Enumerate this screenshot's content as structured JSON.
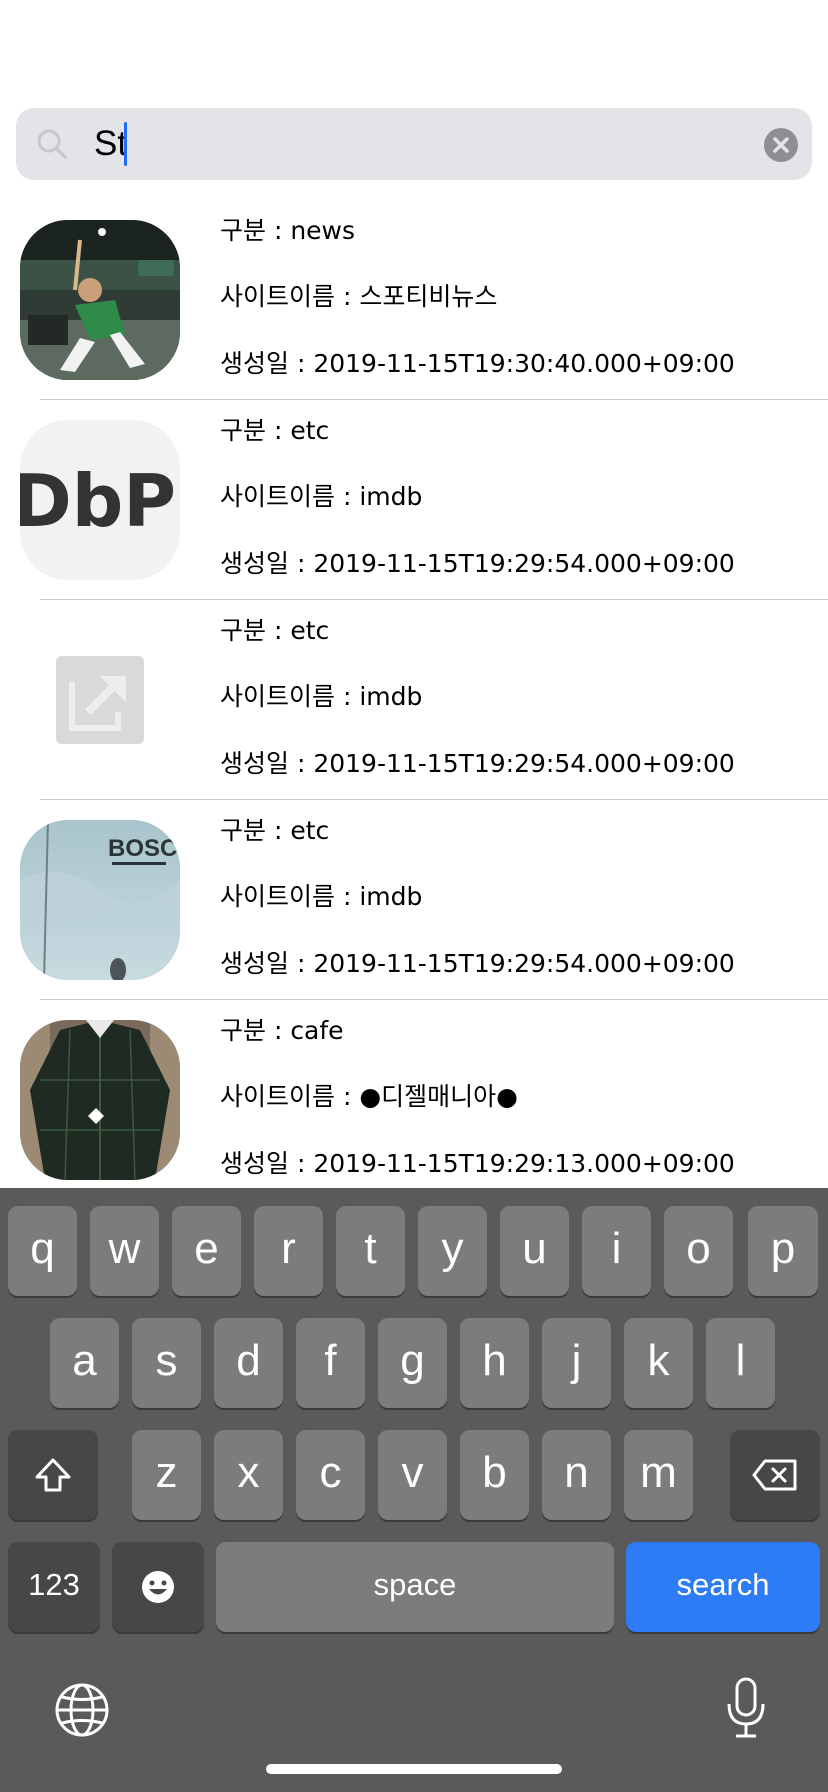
{
  "search": {
    "query": "St"
  },
  "results": [
    {
      "category_line": "구분 : news",
      "site_line": "사이트이름 : 스포티비뉴스",
      "date_line": "생성일 : 2019-11-15T19:30:40.000+09:00"
    },
    {
      "category_line": "구분 : etc",
      "site_line": "사이트이름 : imdb",
      "date_line": "생성일 : 2019-11-15T19:29:54.000+09:00"
    },
    {
      "category_line": "구분 : etc",
      "site_line": "사이트이름 : imdb",
      "date_line": "생성일 : 2019-11-15T19:29:54.000+09:00"
    },
    {
      "category_line": "구분 : etc",
      "site_line": "사이트이름 : imdb",
      "date_line": "생성일 : 2019-11-15T19:29:54.000+09:00"
    },
    {
      "category_line": "구분 : cafe",
      "site_line": "사이트이름 : ●디젤매니아●",
      "date_line": "생성일 : 2019-11-15T19:29:13.000+09:00"
    }
  ],
  "thumb_text": {
    "imdb_logo": "DbP",
    "bosch_title": "BOSCH"
  },
  "keyboard": {
    "row1": [
      "q",
      "w",
      "e",
      "r",
      "t",
      "y",
      "u",
      "i",
      "o",
      "p"
    ],
    "row2": [
      "a",
      "s",
      "d",
      "f",
      "g",
      "h",
      "j",
      "k",
      "l"
    ],
    "row3": [
      "z",
      "x",
      "c",
      "v",
      "b",
      "n",
      "m"
    ],
    "numbers_label": "123",
    "space_label": "space",
    "search_label": "search"
  },
  "colors": {
    "search_key": "#2e7bf6",
    "caret": "#1b6ef5",
    "keyboard_bg": "#5a5a5c"
  }
}
